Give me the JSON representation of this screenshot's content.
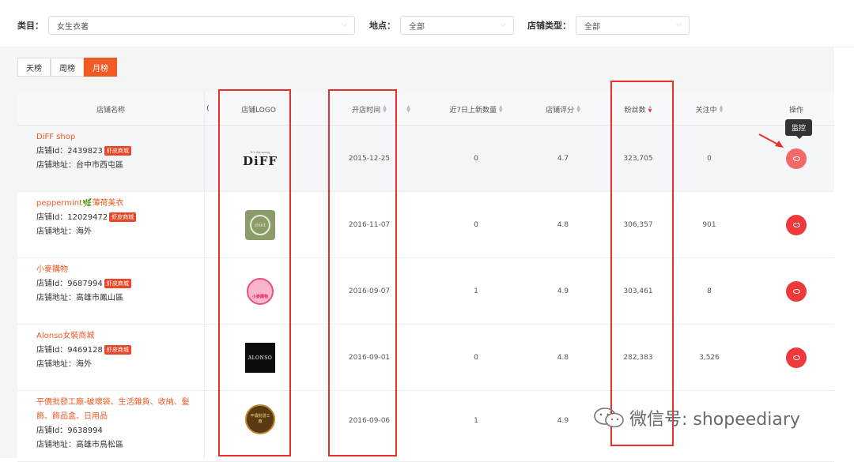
{
  "filters": {
    "category": {
      "label": "类目：",
      "value": "女生衣著"
    },
    "location": {
      "label": "地点：",
      "value": "全部"
    },
    "store_type": {
      "label": "店铺类型：",
      "value": "全部"
    }
  },
  "tabs": [
    {
      "label": "天榜",
      "active": false
    },
    {
      "label": "周榜",
      "active": false
    },
    {
      "label": "月榜",
      "active": true
    }
  ],
  "table": {
    "headers": {
      "shop": "店铺名称",
      "logo": "店铺LOGO",
      "open_date": "开店时间",
      "new_items": "近7日上新数量",
      "rating": "店铺评分",
      "fans": "粉丝数",
      "following": "关注中",
      "action": "操作"
    },
    "rows": [
      {
        "name": "DiFF shop",
        "id_label": "店铺Id：2439823",
        "badge": "虾皮商城",
        "addr": "店铺地址：台中市西屯區",
        "logo": "DiFF",
        "open_date": "2015-12-25",
        "new_items": "0",
        "rating": "4.7",
        "fans": "323,705",
        "following": "0"
      },
      {
        "name": "peppermint🌿薄荷美衣",
        "id_label": "店铺Id：12029472",
        "badge": "虾皮商城",
        "addr": "店铺地址：海外",
        "logo": "mint",
        "open_date": "2016-11-07",
        "new_items": "0",
        "rating": "4.8",
        "fans": "306,357",
        "following": "901"
      },
      {
        "name": "小麥購物",
        "id_label": "店铺Id：9687994",
        "badge": "虾皮商城",
        "addr": "店铺地址：高雄市鳳山區",
        "logo": "小麥購物",
        "open_date": "2016-09-07",
        "new_items": "1",
        "rating": "4.9",
        "fans": "303,461",
        "following": "8"
      },
      {
        "name": "Alonso女裝商城",
        "id_label": "店铺Id：9469128",
        "badge": "虾皮商城",
        "addr": "店铺地址：海外",
        "logo": "ALONSO",
        "open_date": "2016-09-01",
        "new_items": "0",
        "rating": "4.8",
        "fans": "282,383",
        "following": "3,526"
      },
      {
        "name": "平價批發工廠-破壞袋、生活雜貨、收納、髮飾、飾品盒、日用品",
        "id_label": "店铺Id：9638994",
        "badge": "",
        "addr": "店铺地址：高雄市鳥松區",
        "logo": "平價批發工廠",
        "open_date": "2016-09-06",
        "new_items": "1",
        "rating": "4.9",
        "fans": "",
        "following": ""
      }
    ]
  },
  "tooltip": "监控",
  "watermark": "微信号: shopeediary",
  "colors": {
    "accent": "#f05a24",
    "highlight_box": "#e8302a",
    "eye_button": "#ee3a3a"
  }
}
